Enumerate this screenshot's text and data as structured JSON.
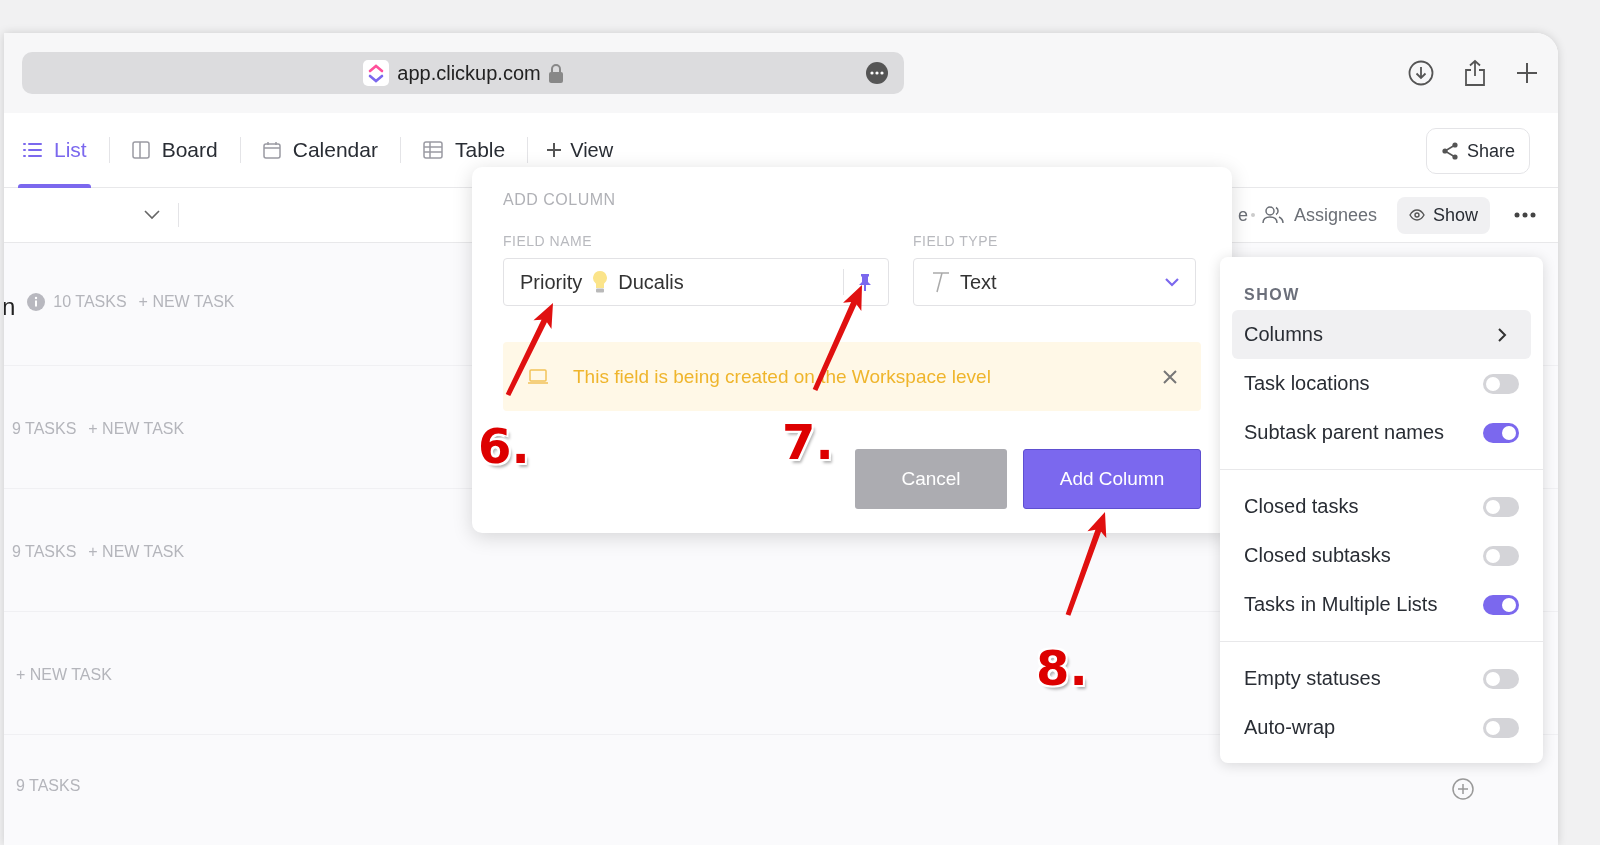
{
  "browser": {
    "address": "app.clickup.com"
  },
  "view_tabs": [
    {
      "label": "List",
      "selected": true
    },
    {
      "label": "Board",
      "selected": false
    },
    {
      "label": "Calendar",
      "selected": false
    },
    {
      "label": "Table",
      "selected": false
    }
  ],
  "add_view": "View",
  "share_button": "Share",
  "toolbar": {
    "partial_label": "e",
    "assignees": "Assignees",
    "show": "Show"
  },
  "groups": [
    {
      "title": "n",
      "count": "10 TASKS",
      "new_task": "+ NEW TASK"
    },
    {
      "count": "9 TASKS",
      "new_task": "+ NEW TASK"
    },
    {
      "count": "9 TASKS",
      "new_task": "+ NEW TASK"
    },
    {
      "new_task": "+ NEW TASK"
    },
    {
      "count": "9 TASKS"
    }
  ],
  "add_column_dialog": {
    "title": "ADD COLUMN",
    "field_name_label": "FIELD NAME",
    "field_name_before_icon": "Priority",
    "field_name_after_icon": "Ducalis",
    "field_type_label": "FIELD TYPE",
    "field_type": "Text",
    "notice": "This field is being created on the Workspace level",
    "buttons": [
      {
        "label": "Cancel",
        "kind": "secondary"
      },
      {
        "label": "Add Column",
        "kind": "primary"
      }
    ]
  },
  "show_menu": {
    "heading": "SHOW",
    "sections": [
      [
        {
          "label": "Columns",
          "kind": "submenu",
          "highlighted": true
        },
        {
          "label": "Task locations",
          "kind": "toggle",
          "highlighted": false,
          "on": false
        },
        {
          "label": "Subtask parent names",
          "kind": "toggle",
          "highlighted": false,
          "on": true
        }
      ],
      [
        {
          "label": "Closed tasks",
          "kind": "toggle",
          "highlighted": false,
          "on": false
        },
        {
          "label": "Closed subtasks",
          "kind": "toggle",
          "highlighted": false,
          "on": false
        },
        {
          "label": "Tasks in Multiple Lists",
          "kind": "toggle",
          "highlighted": false,
          "on": true
        }
      ],
      [
        {
          "label": "Empty statuses",
          "kind": "toggle",
          "highlighted": false,
          "on": false
        },
        {
          "label": "Auto-wrap",
          "kind": "toggle",
          "highlighted": false,
          "on": false
        }
      ]
    ]
  },
  "annotations": [
    {
      "label": "6."
    },
    {
      "label": "7."
    },
    {
      "label": "8."
    }
  ]
}
